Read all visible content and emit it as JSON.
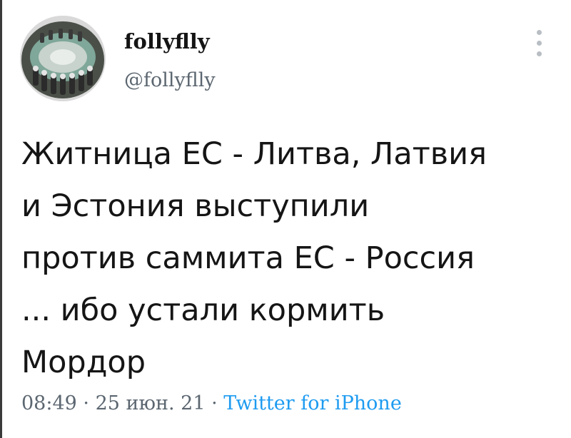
{
  "tweet": {
    "author": {
      "display_name": "follyflly",
      "handle": "@follyflly"
    },
    "more_icon": "more-vertical-icon",
    "text_lines": [
      "Житница ЕС - Литва, Латвия",
      "и Эстония выступили",
      "против саммита ЕС - Россия",
      "... ибо устали кормить",
      "Мордор"
    ],
    "time": "08:49",
    "separator": " · ",
    "date": "25 июн. 21",
    "source": "Twitter for iPhone"
  },
  "colors": {
    "text": "#151515",
    "secondary": "#5b6670",
    "link": "#1d9bf0",
    "icon": "#b8bec3"
  }
}
